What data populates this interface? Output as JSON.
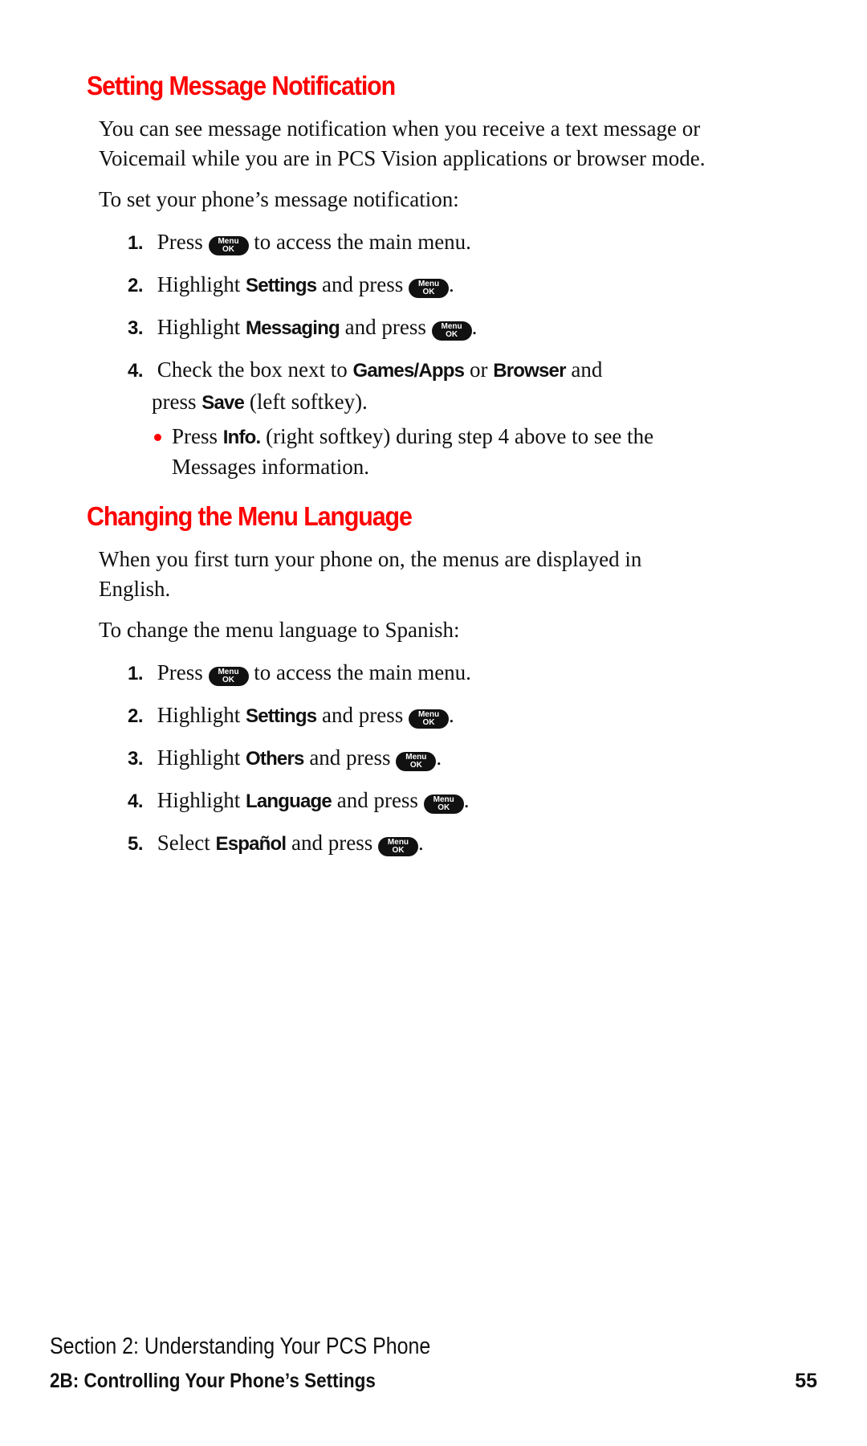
{
  "sections": [
    {
      "heading": "Setting Message Notification",
      "intro": [
        "You can see message notification when you receive a text message or",
        "Voicemail while you are in PCS Vision applications or browser mode."
      ],
      "lead": "To set your phone’s message notification:",
      "steps": [
        {
          "num": "1.",
          "pre": "Press",
          "bold": "",
          "mid": "",
          "post": "to access the main menu.",
          "key": true
        },
        {
          "num": "2.",
          "pre": "Highlight",
          "bold": "Settings",
          "mid": "and press",
          "post": ".",
          "key": true
        },
        {
          "num": "3.",
          "pre": "Highlight",
          "bold": "Messaging",
          "mid": "and press",
          "post": ".",
          "key": true
        },
        {
          "num": "4.",
          "pre": "Check the box next to",
          "bold": "Games/Apps",
          "mid": "or",
          "bold2": "Browser",
          "post": "and",
          "line2_pre": "press",
          "line2_bold": "Save",
          "line2_post": "(left softkey)."
        }
      ],
      "bullet": {
        "pre": "Press",
        "bold": "Info.",
        "post": "(right softkey) during step 4 above to see the",
        "line2": "Messages information."
      }
    },
    {
      "heading": "Changing the Menu Language",
      "intro": [
        "When you first turn your phone on, the menus are displayed in",
        "English."
      ],
      "lead": "To change the menu language to Spanish:",
      "steps": [
        {
          "num": "1.",
          "pre": "Press",
          "bold": "",
          "mid": "",
          "post": "to access the main menu."
        },
        {
          "num": "2.",
          "pre": "Highlight",
          "bold": "Settings",
          "mid": "and press",
          "post": "."
        },
        {
          "num": "3.",
          "pre": "Highlight",
          "bold": "Others",
          "mid": "and press",
          "post": "."
        },
        {
          "num": "4.",
          "pre": "Highlight",
          "bold": "Language",
          "mid": "and press",
          "post": "."
        },
        {
          "num": "5.",
          "pre": "Select",
          "bold": "Español",
          "mid": "and press",
          "post": "."
        }
      ]
    }
  ],
  "key_icon": {
    "top": "Menu",
    "bottom": "OK",
    "name": "menu-ok-key-icon"
  },
  "footer": {
    "section": "Section 2: Understanding Your PCS Phone",
    "chapter": "2B: Controlling Your Phone’s Settings",
    "page": "55"
  },
  "colors": {
    "heading": "#ff0000",
    "bullet": "#ff0000",
    "text": "#111111"
  }
}
